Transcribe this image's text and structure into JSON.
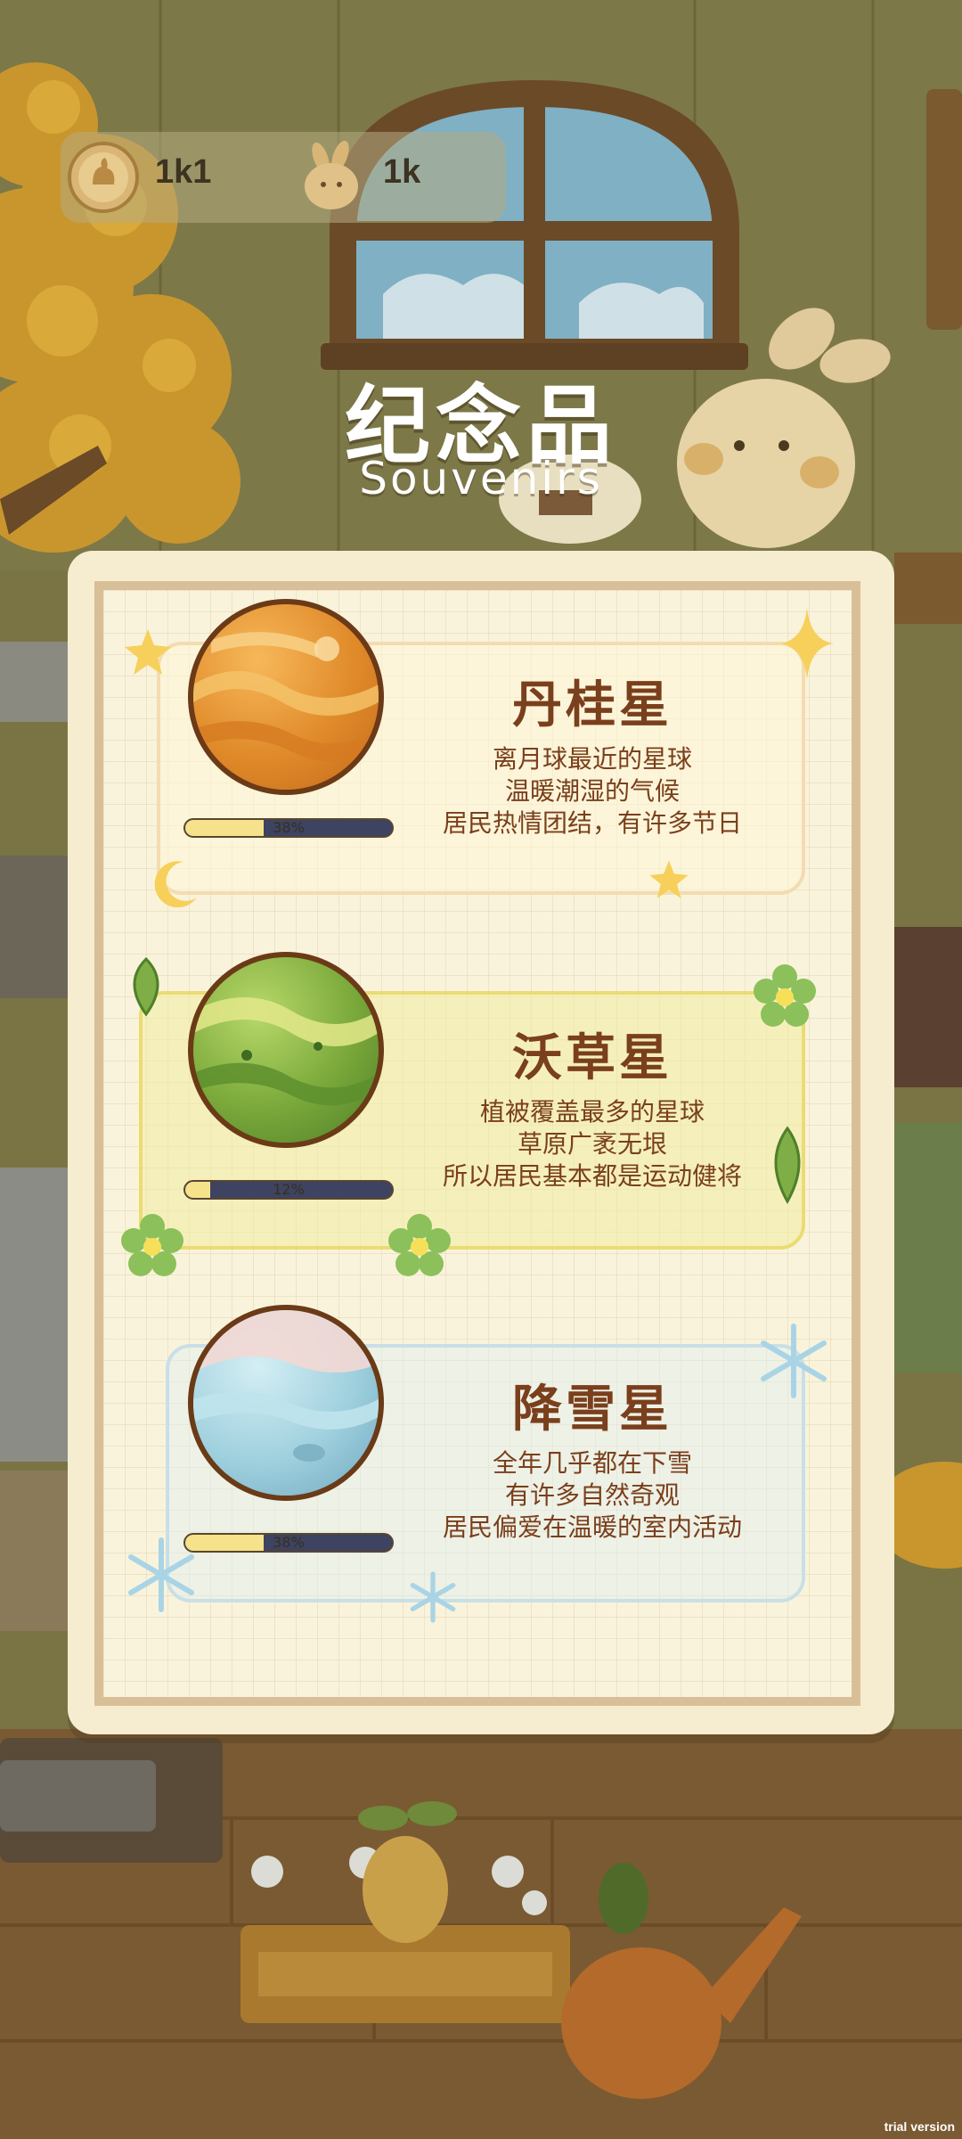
{
  "currency": [
    {
      "icon": "carrot-coin-icon",
      "value": "1k1"
    },
    {
      "icon": "bunny-token-icon",
      "value": "1k"
    }
  ],
  "header": {
    "title": "纪念品",
    "subtitle": "Souvenirs"
  },
  "planets": [
    {
      "name": "丹桂星",
      "lines": [
        "离月球最近的星球",
        "温暖潮湿的气候",
        "居民热情团结，有许多节日"
      ],
      "progress_label": "38%",
      "progress": 0.38,
      "theme": "orange"
    },
    {
      "name": "沃草星",
      "lines": [
        "植被覆盖最多的星球",
        "草原广袤无垠",
        "所以居民基本都是运动健将"
      ],
      "progress_label": "12%",
      "progress": 0.12,
      "theme": "green"
    },
    {
      "name": "降雪星",
      "lines": [
        "全年几乎都在下雪",
        "有许多自然奇观",
        "居民偏爱在温暖的室内活动"
      ],
      "progress_label": "38%",
      "progress": 0.38,
      "theme": "blue"
    }
  ],
  "watermark": "trial version",
  "colors": {
    "text_brown": "#7a3f1c",
    "progress_track": "#3d4360",
    "progress_fill": "#f6e28a"
  }
}
